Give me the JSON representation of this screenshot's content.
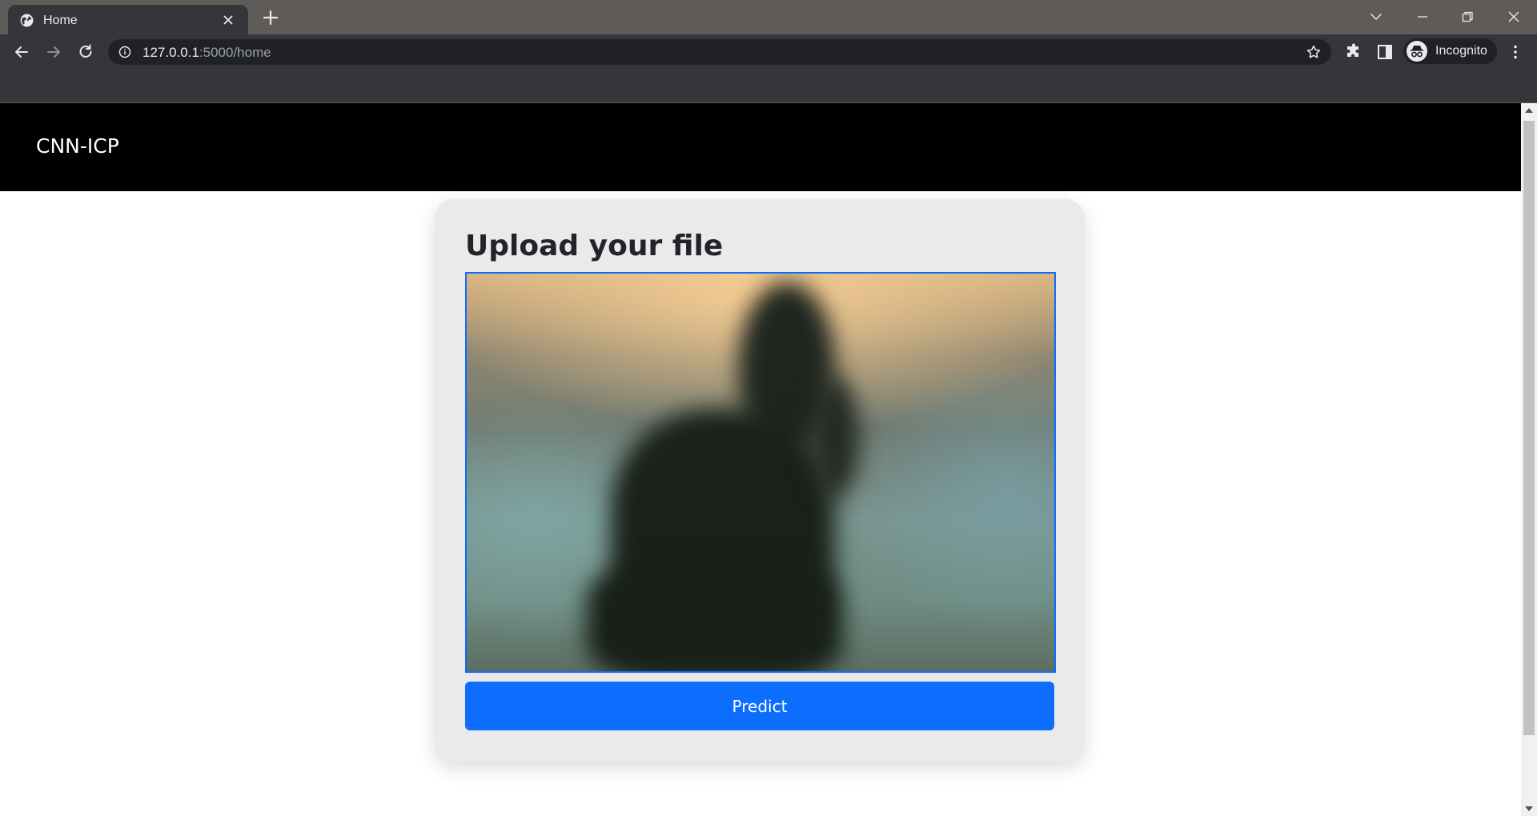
{
  "browser": {
    "tab": {
      "title": "Home",
      "favicon": "globe-icon"
    },
    "address": {
      "host": "127.0.0.1",
      "path": ":5000/home"
    },
    "profile": {
      "label": "Incognito",
      "icon": "incognito-icon"
    }
  },
  "navbar": {
    "brand": "CNN-ICP",
    "background": "#000000"
  },
  "upload_card": {
    "title": "Upload your file",
    "preview_alt": "uploaded image preview",
    "predict_label": "Predict",
    "accent": "#0d6efd"
  }
}
